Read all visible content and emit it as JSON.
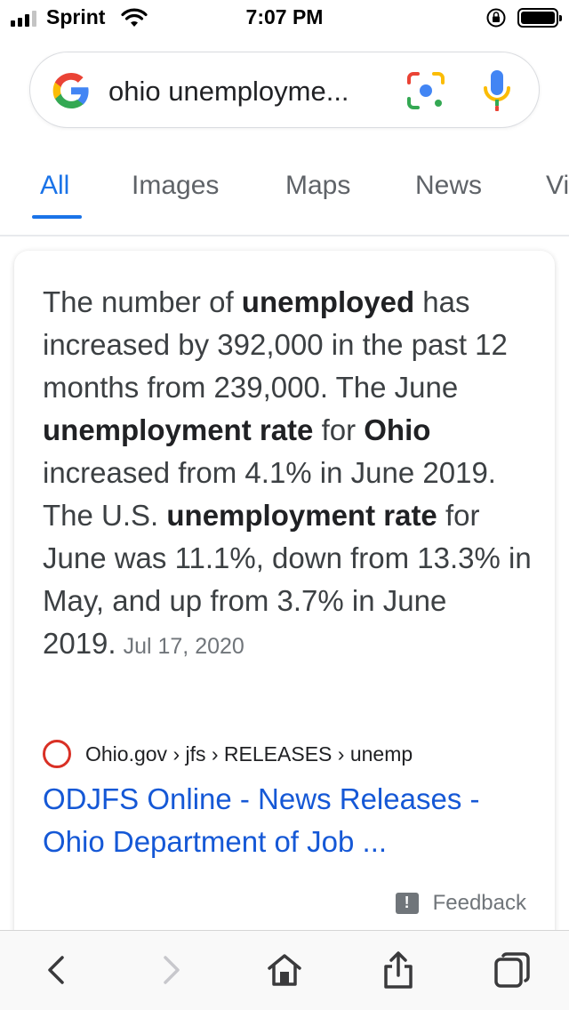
{
  "status_bar": {
    "carrier": "Sprint",
    "time": "7:07 PM"
  },
  "search": {
    "query": "ohio unemployme...",
    "icons": [
      "google-logo",
      "lens-icon",
      "mic-icon"
    ]
  },
  "tabs": [
    {
      "label": "All",
      "active": true
    },
    {
      "label": "Images",
      "active": false
    },
    {
      "label": "Maps",
      "active": false
    },
    {
      "label": "News",
      "active": false
    },
    {
      "label": "Vi",
      "active": false
    }
  ],
  "featured_snippet": {
    "parts": [
      {
        "text": "The number of ",
        "bold": false
      },
      {
        "text": "unemployed",
        "bold": true
      },
      {
        "text": " has increased by 392,000 in the past 12 months from 239,000. The June ",
        "bold": false
      },
      {
        "text": "unemployment rate",
        "bold": true
      },
      {
        "text": " for ",
        "bold": false
      },
      {
        "text": "Ohio",
        "bold": true
      },
      {
        "text": " increased from 4.1% in June 2019. The U.S. ",
        "bold": false
      },
      {
        "text": "unemployment rate",
        "bold": true
      },
      {
        "text": " for June was 11.1%, down from 13.3% in May, and up from 3.7% in June 2019.",
        "bold": false
      }
    ],
    "date": "Jul 17, 2020"
  },
  "result": {
    "breadcrumb": "Ohio.gov › jfs › RELEASES › unemp",
    "title": "ODJFS Online - News Releases - Ohio Department of Job ..."
  },
  "feedback": {
    "label": "Feedback"
  },
  "colors": {
    "accent": "#1a73e8",
    "link": "#1558d6",
    "favicon_ring": "#d93025"
  }
}
